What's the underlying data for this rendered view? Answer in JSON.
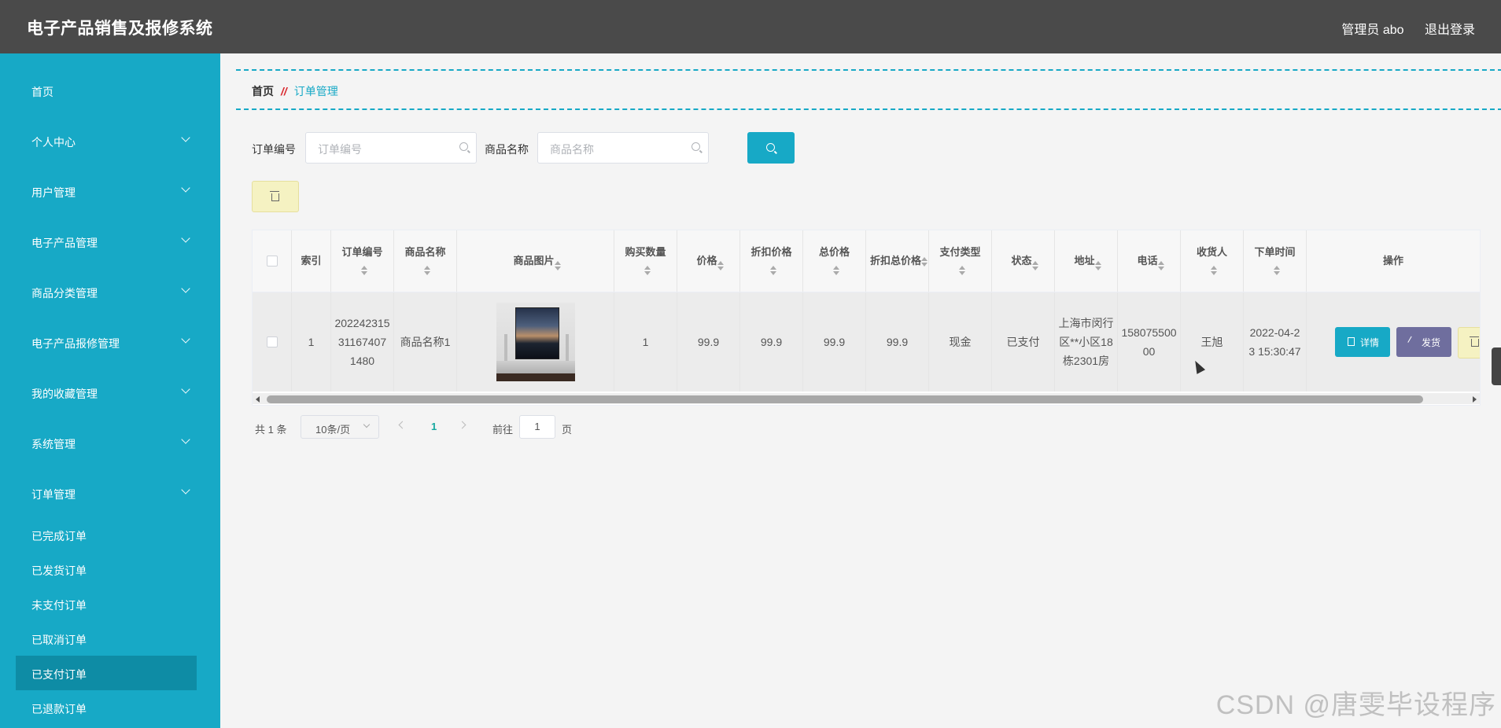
{
  "header": {
    "app_title": "电子产品销售及报修系统",
    "user_label": "管理员 abo",
    "logout_label": "退出登录"
  },
  "sidebar": {
    "items": [
      {
        "label": "首页",
        "expandable": false
      },
      {
        "label": "个人中心",
        "expandable": true
      },
      {
        "label": "用户管理",
        "expandable": true
      },
      {
        "label": "电子产品管理",
        "expandable": true
      },
      {
        "label": "商品分类管理",
        "expandable": true
      },
      {
        "label": "电子产品报修管理",
        "expandable": true
      },
      {
        "label": "我的收藏管理",
        "expandable": true
      },
      {
        "label": "系统管理",
        "expandable": true
      },
      {
        "label": "订单管理",
        "expandable": true
      }
    ],
    "sub_items": [
      {
        "label": "已完成订单"
      },
      {
        "label": "已发货订单"
      },
      {
        "label": "未支付订单"
      },
      {
        "label": "已取消订单"
      },
      {
        "label": "已支付订单",
        "active": true
      },
      {
        "label": "已退款订单"
      }
    ]
  },
  "breadcrumb": {
    "home": "首页",
    "separator": "//",
    "current": "订单管理"
  },
  "search": {
    "order_no_label": "订单编号",
    "order_no_placeholder": "订单编号",
    "product_name_label": "商品名称",
    "product_name_placeholder": "商品名称"
  },
  "table": {
    "headers": [
      "索引",
      "订单编号",
      "商品名称",
      "商品图片",
      "购买数量",
      "价格",
      "折扣价格",
      "总价格",
      "折扣总价格",
      "支付类型",
      "状态",
      "地址",
      "电话",
      "收货人",
      "下单时间",
      "操作"
    ],
    "rows": [
      {
        "index": "1",
        "order_no": "20224231531167407 1480",
        "product_name": "商品名称1",
        "image_alt": "tv-product-image",
        "quantity": "1",
        "price": "99.9",
        "discount_price": "99.9",
        "total_price": "99.9",
        "discount_total": "99.9",
        "pay_type": "现金",
        "status": "已支付",
        "address": "上海市闵行区**小区18栋2301房",
        "phone": "15807550000",
        "receiver": "王旭",
        "order_time": "2022-04-23 15:30:47"
      }
    ],
    "actions": {
      "detail": "详情",
      "ship": "发货"
    }
  },
  "pagination": {
    "total": "共 1 条",
    "page_size": "10条/页",
    "current_page": "1",
    "goto_label": "前往",
    "goto_value": "1",
    "page_suffix": "页"
  },
  "watermark": "CSDN @唐雯毕设程序",
  "colors": {
    "header_bg": "#4a4a4a",
    "sidebar_bg": "#17a9c6",
    "sidebar_active": "#0e8ca5",
    "detail_btn": "#17a9c6",
    "ship_btn": "#6f6e9e",
    "delete_btn": "#f5f2c2"
  }
}
